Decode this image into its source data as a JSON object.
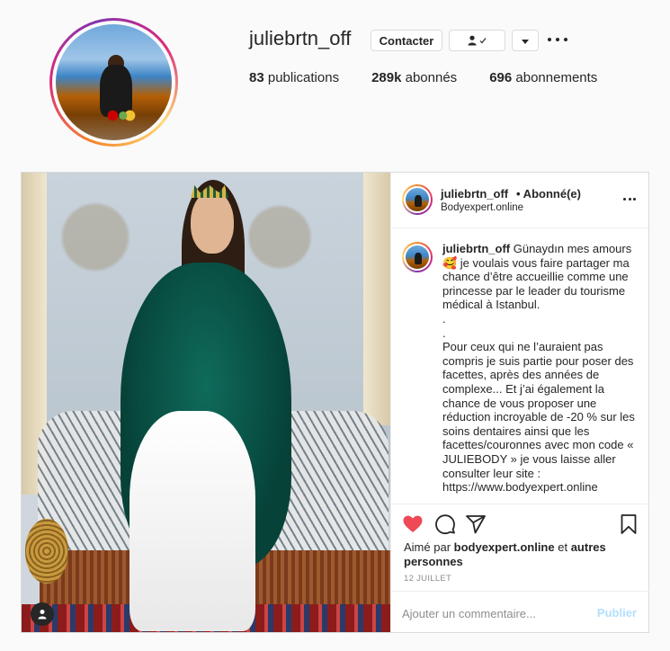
{
  "profile": {
    "username": "juliebrtn_off",
    "contact_label": "Contacter",
    "stats": {
      "posts_value": "83",
      "posts_label": "publications",
      "followers_value": "289k",
      "followers_label": "abonnés",
      "following_value": "696",
      "following_label": "abonnements"
    }
  },
  "post": {
    "header": {
      "username": "juliebrtn_off",
      "follow_status": "• Abonné(e)",
      "location": "Bodyexpert.online"
    },
    "caption": {
      "username": "juliebrtn_off",
      "text": "Günaydın mes amours 🥰 je voulais vous faire partager ma chance d’être accueillie comme une princesse par le leader du tourisme médical à Istanbul.\n.\n.\nPour ceux qui ne l’auraient pas compris je suis partie pour poser des facettes, après des années de complexe... Et j’ai également la chance de vous proposer une réduction incroyable de -20 % sur les soins dentaires ainsi que les facettes/couronnes avec mon code « JULIEBODY » je vous laisse aller consulter leur site :\nhttps://www.bodyexpert.online"
    },
    "likes": {
      "prefix": "Aimé par ",
      "liker": "bodyexpert.online",
      "middle": " et ",
      "others": "autres personnes"
    },
    "date": "12 JUILLET",
    "comment": {
      "placeholder": "Ajouter un commentaire...",
      "publish_label": "Publier"
    }
  },
  "colors": {
    "heart": "#ed4956",
    "publish_disabled": "#b2dffc",
    "text": "#262626",
    "muted": "#8e8e8e",
    "border": "#dbdbdb"
  },
  "icons": {
    "follow_button": "user-check-icon",
    "dropdown": "chevron-down-icon",
    "more": "more-horizontal-icon",
    "like": "heart-filled-icon",
    "comment": "comment-icon",
    "share": "share-icon",
    "save": "bookmark-icon",
    "tags": "user-tag-icon"
  }
}
